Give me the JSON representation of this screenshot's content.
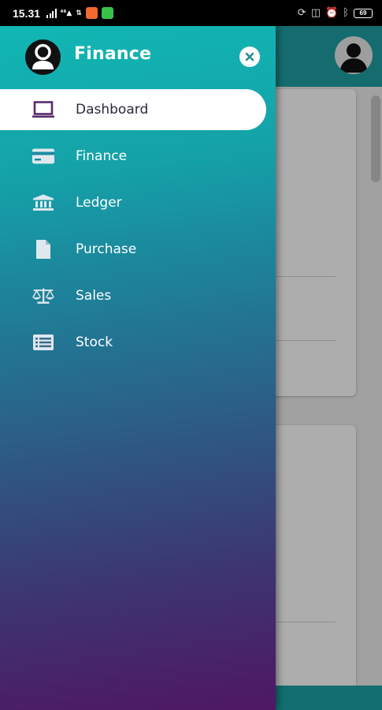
{
  "status_bar": {
    "time": "15.31",
    "battery": "69"
  },
  "drawer": {
    "brand": "Finance",
    "menu": [
      {
        "label": "Dashboard",
        "icon": "laptop-icon",
        "active": true
      },
      {
        "label": "Finance",
        "icon": "credit-card-icon",
        "active": false
      },
      {
        "label": "Ledger",
        "icon": "bank-icon",
        "active": false
      },
      {
        "label": "Purchase",
        "icon": "document-icon",
        "active": false
      },
      {
        "label": "Sales",
        "icon": "balance-scale-icon",
        "active": false
      },
      {
        "label": "Stock",
        "icon": "list-icon",
        "active": false
      }
    ]
  },
  "colors": {
    "drawer_top": "#12b7b4",
    "drawer_bottom": "#4f1764",
    "active_icon": "#5a2a6e",
    "header": "#1e9fa3"
  }
}
